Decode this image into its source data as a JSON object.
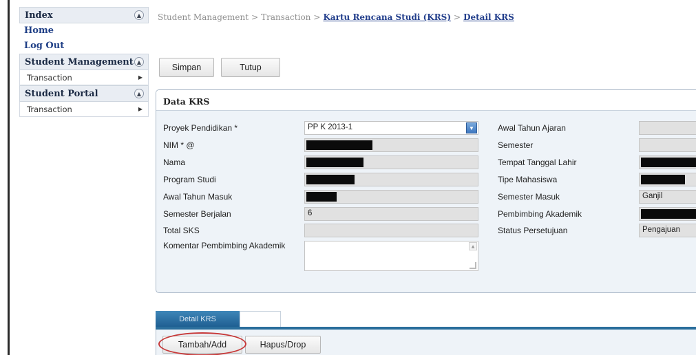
{
  "sidebar": {
    "index_title": "Index",
    "links": [
      "Home",
      "Log Out"
    ],
    "sections": [
      {
        "title": "Student Management",
        "item": "Transaction"
      },
      {
        "title": "Student Portal",
        "item": "Transaction"
      }
    ]
  },
  "breadcrumb": {
    "part1": "Student Management",
    "part2": "Transaction",
    "part3": "Kartu Rencana Studi (KRS)",
    "part4": "Detail KRS",
    "separator": ">"
  },
  "toolbar": {
    "save_label": "Simpan",
    "close_label": "Tutup"
  },
  "panel": {
    "title": "Data KRS",
    "left_fields": {
      "proyek_label": "Proyek Pendidikan *",
      "proyek_value": "PP K 2013-1",
      "nim_label": "NIM * @",
      "nama_label": "Nama",
      "prodi_label": "Program Studi",
      "awal_masuk_label": "Awal Tahun Masuk",
      "semester_berjalan_label": "Semester Berjalan",
      "semester_berjalan_value": "6",
      "total_sks_label": "Total SKS",
      "komentar_label": "Komentar Pembimbing Akademik"
    },
    "right_fields": {
      "awal_ajaran_label": "Awal Tahun Ajaran",
      "semester_label": "Semester",
      "ttl_label": "Tempat Tanggal Lahir",
      "tipe_label": "Tipe Mahasiswa",
      "semester_masuk_label": "Semester Masuk",
      "semester_masuk_value": "Ganjil",
      "pembimbing_label": "Pembimbing Akademik",
      "status_label": "Status Persetujuan",
      "status_value": "Pengajuan"
    }
  },
  "tabs": {
    "active_label": "Detail KRS"
  },
  "actions": {
    "add_label": "Tambah/Add",
    "drop_label": "Hapus/Drop"
  },
  "colors": {
    "accent": "#233f8c",
    "tab_blue": "#2a6e9c",
    "highlight": "#c73a3a"
  }
}
